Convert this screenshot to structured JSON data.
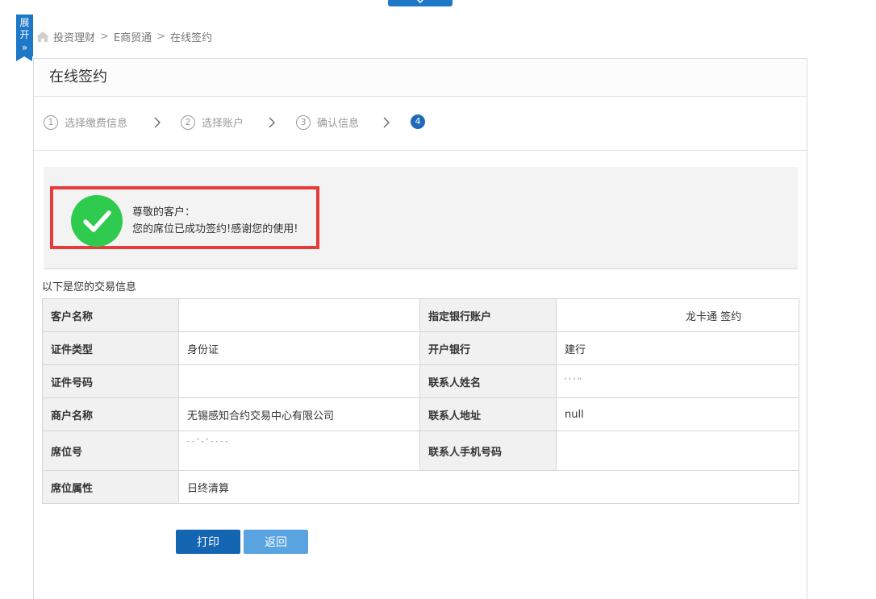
{
  "breadcrumb": {
    "items": [
      "投资理财",
      "E商贸通",
      "在线签约"
    ],
    "separator": ">"
  },
  "expand_tab": {
    "label": "展开",
    "chevrons": "»"
  },
  "panel": {
    "title": "在线签约"
  },
  "steps": [
    {
      "num": "1",
      "label": "选择缴费信息"
    },
    {
      "num": "2",
      "label": "选择账户"
    },
    {
      "num": "3",
      "label": "确认信息"
    },
    {
      "num": "4",
      "label": ""
    }
  ],
  "success": {
    "line1": "尊敬的客户：",
    "line2": "您的席位已成功签约!感谢您的使用!"
  },
  "info": {
    "title": "以下是您的交易信息",
    "rows": [
      {
        "l1": "客户名称",
        "v1": "",
        "l2": "指定银行账户",
        "v2": "龙卡通 签约"
      },
      {
        "l1": "证件类型",
        "v1": "身份证",
        "l2": "开户银行",
        "v2": "建行"
      },
      {
        "l1": "证件号码",
        "v1": "",
        "l2": "联系人姓名",
        "v2": "' ' ' ''"
      },
      {
        "l1": "商户名称",
        "v1": "无锡感知合约交易中心有限公司",
        "l2": "联系人地址",
        "v2": "null"
      },
      {
        "l1": "席位号",
        "v1": "- - ' - ' - - - -",
        "l2": "联系人手机号码",
        "v2": ""
      }
    ],
    "last_row": {
      "l1": "席位属性",
      "v1": "日终清算"
    }
  },
  "buttons": {
    "print": "打印",
    "back": "返回"
  },
  "colors": {
    "accent": "#1e78c8",
    "success": "#2fcb4f",
    "highlight": "#e93a3a"
  }
}
